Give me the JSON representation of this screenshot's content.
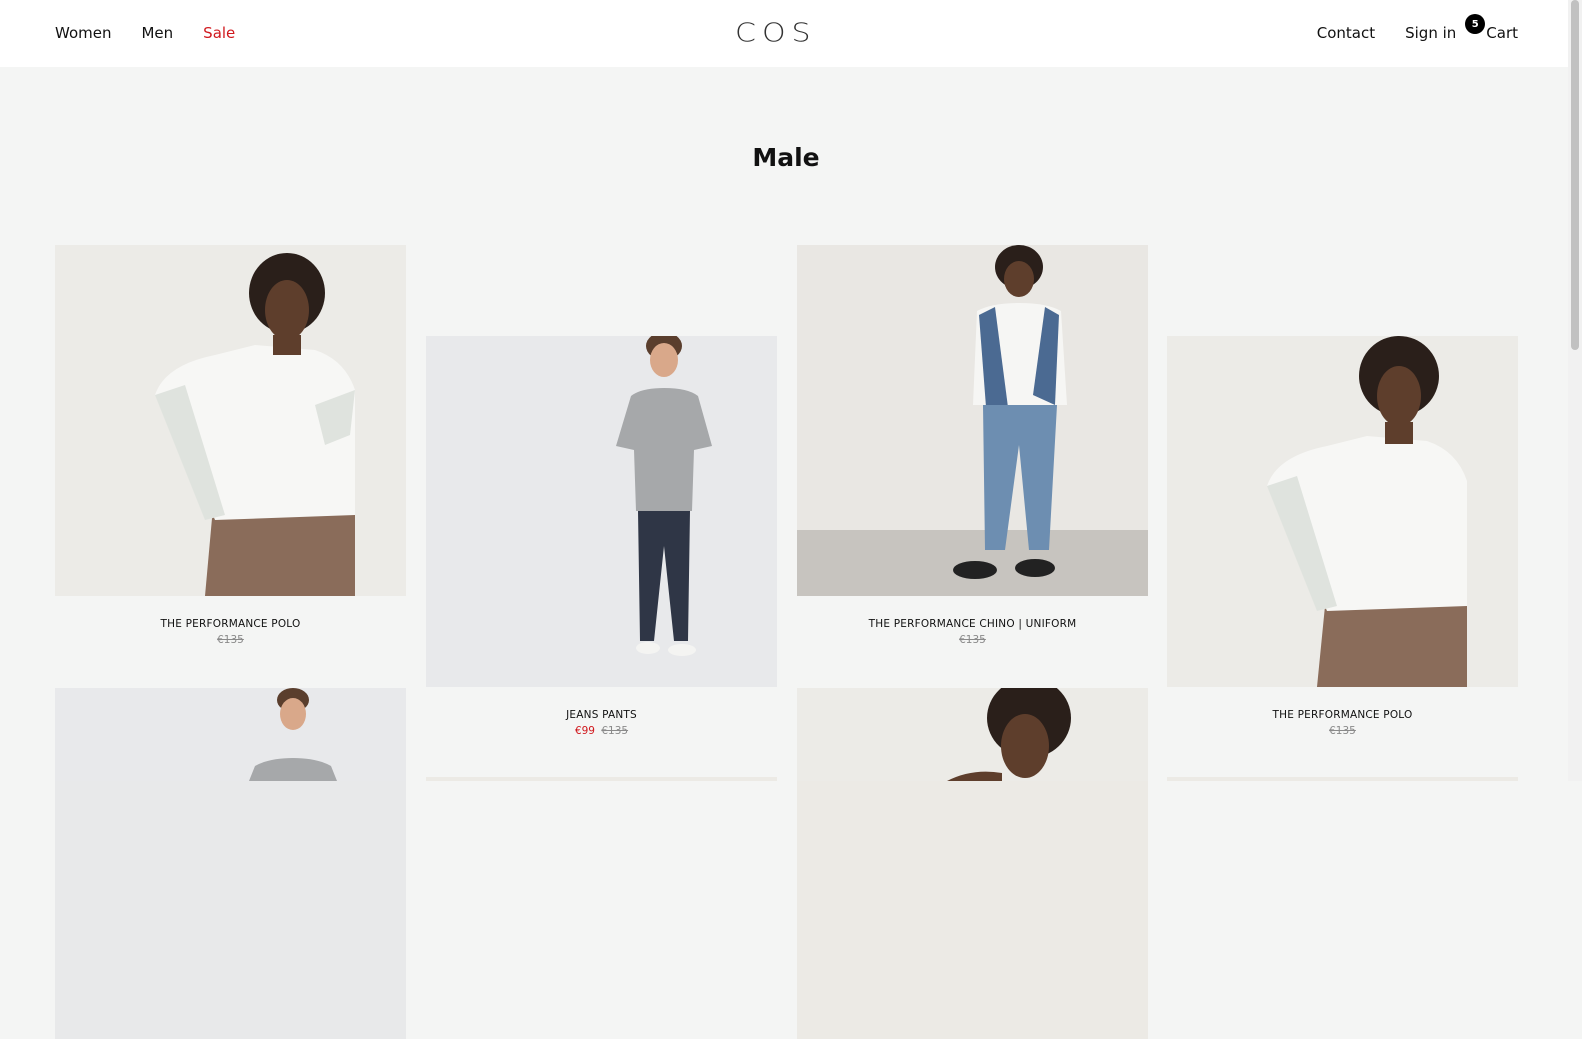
{
  "nav": {
    "women": "Women",
    "men": "Men",
    "sale": "Sale",
    "logo": "COS",
    "contact": "Contact",
    "signin": "Sign in",
    "cart": "Cart",
    "cart_count": "5"
  },
  "page_title": "Male",
  "products": [
    {
      "name": "THE PERFORMANCE POLO",
      "old_price": "€135",
      "sale_price": ""
    },
    {
      "name": "JEANS PANTS",
      "old_price": "€135",
      "sale_price": "€99"
    },
    {
      "name": "THE PERFORMANCE CHINO | UNIFORM",
      "old_price": "€135",
      "sale_price": ""
    },
    {
      "name": "THE PERFORMANCE POLO",
      "old_price": "€135",
      "sale_price": ""
    }
  ],
  "colors": {
    "sale_red": "#d0191e",
    "background": "#f4f5f4"
  }
}
